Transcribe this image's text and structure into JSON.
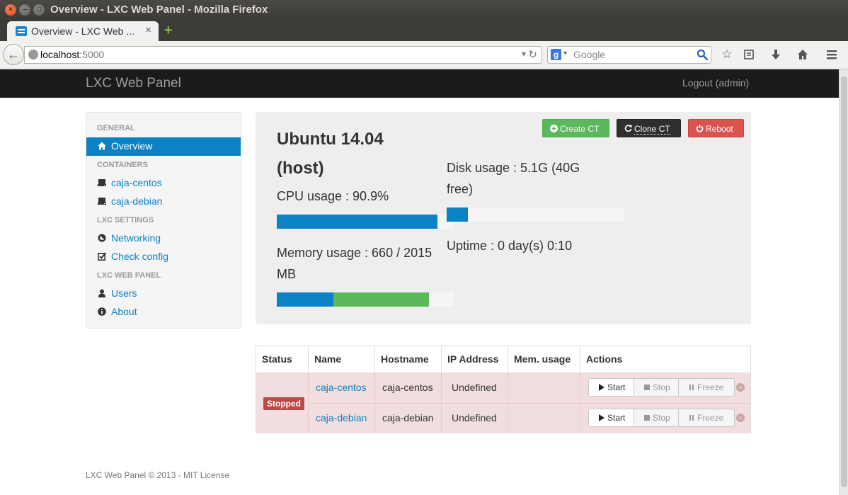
{
  "window": {
    "title": "Overview - LXC Web Panel - Mozilla Firefox",
    "controls": [
      "×",
      "–",
      "□"
    ]
  },
  "browser": {
    "tab_label": "Overview - LXC Web ...",
    "tab_close": "×",
    "new_tab": "+",
    "url_host": "localhost",
    "url_port": ":5000",
    "search_placeholder": "Google",
    "search_engine_letter": "g",
    "toolbar_icons": [
      "star-icon",
      "bookmarks-icon",
      "downloads-icon",
      "home-icon",
      "menu-icon"
    ]
  },
  "app": {
    "brand": "LXC Web Panel",
    "logout": "Logout (admin)"
  },
  "sidebar": {
    "sections": [
      {
        "header": "GENERAL",
        "items": [
          {
            "label": "Overview",
            "icon": "home-icon",
            "active": true
          }
        ]
      },
      {
        "header": "CONTAINERS",
        "items": [
          {
            "label": "caja-centos",
            "icon": "server-icon"
          },
          {
            "label": "caja-debian",
            "icon": "server-icon"
          }
        ]
      },
      {
        "header": "LXC SETTINGS",
        "items": [
          {
            "label": "Networking",
            "icon": "globe-icon"
          },
          {
            "label": "Check config",
            "icon": "check-icon"
          }
        ]
      },
      {
        "header": "LXC WEB PANEL",
        "items": [
          {
            "label": "Users",
            "icon": "user-icon"
          },
          {
            "label": "About",
            "icon": "info-icon"
          }
        ]
      }
    ]
  },
  "host": {
    "name": "Ubuntu 14.04 (host)",
    "cpu_label": "CPU usage : 90.9%",
    "cpu_percent": 90.9,
    "memory_label": "Memory usage : 660 / 2015 MB",
    "memory_bar": {
      "blue_fraction": 0.32,
      "green_fraction": 0.54
    },
    "disk_label": "Disk usage : 5.1G (40G free)",
    "disk_fraction": 0.12,
    "uptime_label": "Uptime : 0 day(s) 0:10",
    "colors": {
      "primary": "#0b81c6",
      "success": "#5cb85c",
      "danger": "#d9534f",
      "bar_bg": "#f5f5f5"
    }
  },
  "actions": {
    "create": "Create CT",
    "clone": "Clone CT",
    "reboot": "Reboot"
  },
  "containers_table": {
    "headers": [
      "Status",
      "Name",
      "Hostname",
      "IP Address",
      "Mem. usage",
      "Actions"
    ],
    "status_badge": "Stopped",
    "rows": [
      {
        "name": "caja-centos",
        "hostname": "caja-centos",
        "ip": "Undefined",
        "mem": ""
      },
      {
        "name": "caja-debian",
        "hostname": "caja-debian",
        "ip": "Undefined",
        "mem": ""
      }
    ],
    "row_buttons": {
      "start": "Start",
      "stop": "Stop",
      "freeze": "Freeze"
    }
  },
  "footer": "LXC Web Panel © 2013 - MIT License"
}
